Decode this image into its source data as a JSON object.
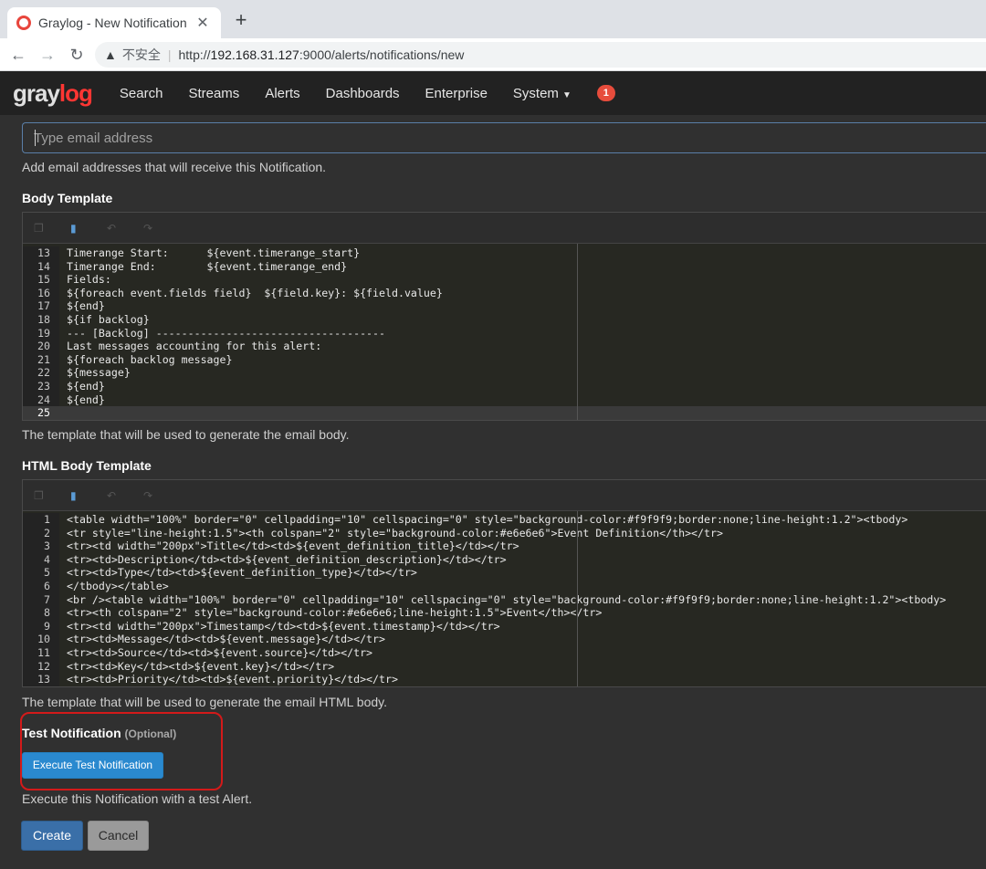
{
  "browser": {
    "tab_title": "Graylog - New Notification",
    "tab_close": "✕",
    "new_tab": "+",
    "insecure_label": "不安全",
    "url_separator": "|",
    "url_prefix": "http://",
    "url_host": "192.168.31.127",
    "url_rest": ":9000/alerts/notifications/new"
  },
  "nav": {
    "logo_a": "gray",
    "logo_b": "log",
    "items": [
      "Search",
      "Streams",
      "Alerts",
      "Dashboards",
      "Enterprise",
      "System"
    ],
    "notification_count": "1"
  },
  "form": {
    "email_placeholder": "Type email address",
    "email_help": "Add email addresses that will receive this Notification.",
    "body_template_label": "Body Template",
    "body_template_help": "The template that will be used to generate the email body.",
    "html_body_template_label": "HTML Body Template",
    "html_body_template_help": "The template that will be used to generate the email HTML body.",
    "test_label": "Test Notification",
    "test_optional": "(Optional)",
    "test_button": "Execute Test Notification",
    "test_help": "Execute this Notification with a test Alert.",
    "create_button": "Create",
    "cancel_button": "Cancel"
  },
  "body_code": [
    {
      "n": "13",
      "t": "Timerange Start:      ${event.timerange_start}"
    },
    {
      "n": "14",
      "t": "Timerange End:        ${event.timerange_end}"
    },
    {
      "n": "15",
      "t": "Fields:"
    },
    {
      "n": "16",
      "t": "${foreach event.fields field}  ${field.key}: ${field.value}"
    },
    {
      "n": "17",
      "t": "${end}"
    },
    {
      "n": "18",
      "t": "${if backlog}"
    },
    {
      "n": "19",
      "t": "--- [Backlog] ------------------------------------"
    },
    {
      "n": "20",
      "t": "Last messages accounting for this alert:"
    },
    {
      "n": "21",
      "t": "${foreach backlog message}"
    },
    {
      "n": "22",
      "t": "${message}"
    },
    {
      "n": "23",
      "t": "${end}"
    },
    {
      "n": "24",
      "t": "${end}"
    },
    {
      "n": "25",
      "t": ""
    }
  ],
  "html_code": [
    {
      "n": "1",
      "t": "<table width=\"100%\" border=\"0\" cellpadding=\"10\" cellspacing=\"0\" style=\"background-color:#f9f9f9;border:none;line-height:1.2\"><tbody>"
    },
    {
      "n": "2",
      "t": "<tr style=\"line-height:1.5\"><th colspan=\"2\" style=\"background-color:#e6e6e6\">Event Definition</th></tr>"
    },
    {
      "n": "3",
      "t": "<tr><td width=\"200px\">Title</td><td>${event_definition_title}</td></tr>"
    },
    {
      "n": "4",
      "t": "<tr><td>Description</td><td>${event_definition_description}</td></tr>"
    },
    {
      "n": "5",
      "t": "<tr><td>Type</td><td>${event_definition_type}</td></tr>"
    },
    {
      "n": "6",
      "t": "</tbody></table>"
    },
    {
      "n": "7",
      "t": "<br /><table width=\"100%\" border=\"0\" cellpadding=\"10\" cellspacing=\"0\" style=\"background-color:#f9f9f9;border:none;line-height:1.2\"><tbody>"
    },
    {
      "n": "8",
      "t": "<tr><th colspan=\"2\" style=\"background-color:#e6e6e6;line-height:1.5\">Event</th></tr>"
    },
    {
      "n": "9",
      "t": "<tr><td width=\"200px\">Timestamp</td><td>${event.timestamp}</td></tr>"
    },
    {
      "n": "10",
      "t": "<tr><td>Message</td><td>${event.message}</td></tr>"
    },
    {
      "n": "11",
      "t": "<tr><td>Source</td><td>${event.source}</td></tr>"
    },
    {
      "n": "12",
      "t": "<tr><td>Key</td><td>${event.key}</td></tr>"
    },
    {
      "n": "13",
      "t": "<tr><td>Priority</td><td>${event.priority}</td></tr>"
    }
  ]
}
